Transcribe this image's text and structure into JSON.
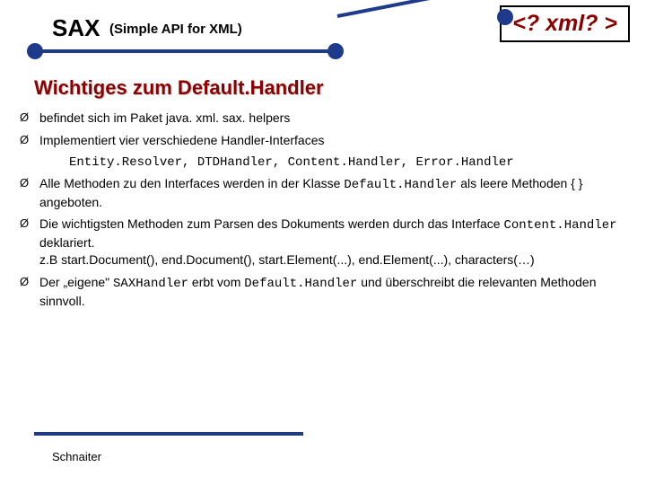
{
  "header": {
    "title_main": "SAX",
    "title_sub": "(Simple API for XML)",
    "xml_box": "<? xml? >"
  },
  "subtitle": "Wichtiges zum Default.Handler",
  "bullets": {
    "b1": "befindet sich im Paket java. xml. sax. helpers",
    "b2": "Implementiert vier verschiedene Handler-Interfaces",
    "b2_sub": "Entity.Resolver, DTDHandler, Content.Handler, Error.Handler",
    "b3_pre": "Alle Methoden zu den Interfaces werden in der Klasse ",
    "b3_code": "Default.Handler",
    "b3_post": " als leere Methoden { } angeboten.",
    "b4_pre": "Die wichtigsten Methoden zum Parsen des Dokuments werden durch das Interface ",
    "b4_code": "Content.Handler",
    "b4_post": " deklariert.",
    "b4_line2": "z.B start.Document(), end.Document(), start.Element(...), end.Element(...), characters(…)",
    "b5_pre": "Der „eigene\" ",
    "b5_code1": "SAXHandler",
    "b5_mid": " erbt vom ",
    "b5_code2": "Default.Handler",
    "b5_post": " und überschreibt die relevanten Methoden sinnvoll."
  },
  "arrow": "Ø",
  "footer": "Schnaiter"
}
